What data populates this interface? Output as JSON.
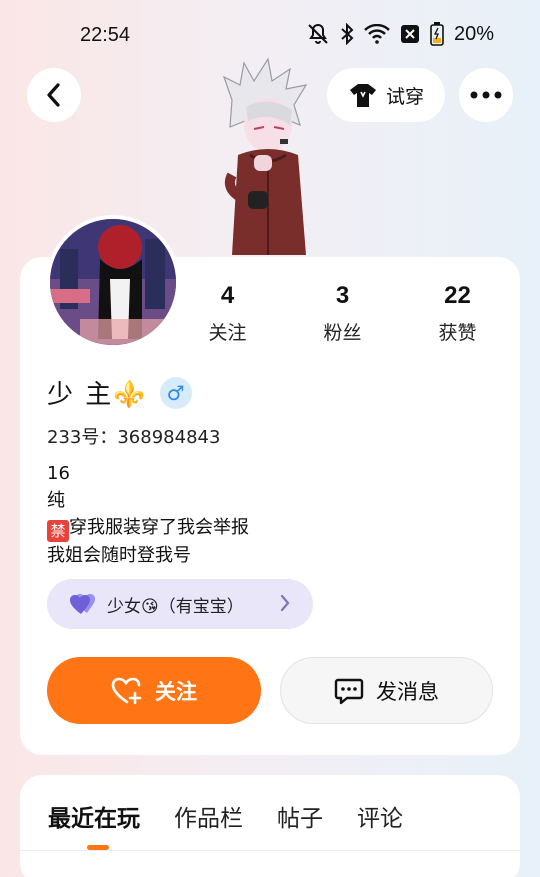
{
  "status_bar": {
    "time": "22:54",
    "battery": "20%",
    "icons": [
      "mute-bell-icon",
      "bluetooth-icon",
      "wifi-icon",
      "sim-icon",
      "battery-icon"
    ]
  },
  "top_bar": {
    "back_icon": "chevron-left-icon",
    "try_on_label": "试穿",
    "try_on_icon": "shirt-icon",
    "more_icon": "more-dots-icon"
  },
  "profile": {
    "name": "少 主⚜️",
    "gender_symbol": "♂",
    "uid_text": "233号：368984843",
    "bio_lines": [
      "16",
      "纯",
      "穿我服装穿了我会举报",
      "我姐会随时登我号"
    ],
    "ban_badge": "禁",
    "stats": [
      {
        "value": "4",
        "label": "关注"
      },
      {
        "value": "3",
        "label": "粉丝"
      },
      {
        "value": "22",
        "label": "获赞"
      }
    ],
    "relation_tag": "少女😘（有宝宝）"
  },
  "actions": {
    "follow_label": "关注",
    "message_label": "发消息"
  },
  "tabs": [
    {
      "label": "最近在玩",
      "active": true
    },
    {
      "label": "作品栏",
      "active": false
    },
    {
      "label": "帖子",
      "active": false
    },
    {
      "label": "评论",
      "active": false
    }
  ],
  "colors": {
    "accent": "#ff7414",
    "gender_blue": "#2f8ae6",
    "tag_bg": "#e9e6f9",
    "heart_purple": "#7b6be0"
  }
}
